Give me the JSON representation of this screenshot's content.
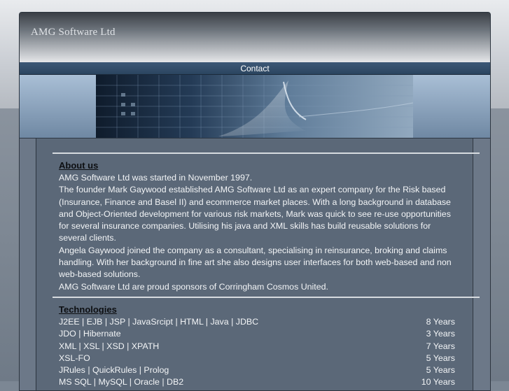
{
  "site": {
    "logo": "AMG Software Ltd"
  },
  "nav": {
    "items": [
      {
        "label": "Contact"
      }
    ]
  },
  "about": {
    "title": "About us",
    "paragraphs": [
      "AMG Software Ltd was started in November 1997.",
      "The founder Mark Gaywood established AMG Software Ltd as an expert company for the Risk based (Insurance, Finance and Basel II) and ecommerce market places. With a long background in database and Object-Oriented development for various risk markets, Mark was quick to see re-use opportunities for several insurance companies. Utilising his java and XML skills has build reusable solutions for several clients.",
      "Angela Gaywood joined the company as a consultant, specialising in reinsurance, broking and claims handling. With her background in fine art she also designs user interfaces for both web-based and non web-based solutions.",
      "AMG Software Ltd are proud sponsors of Corringham Cosmos United."
    ]
  },
  "technologies": {
    "title": "Technologies",
    "rows": [
      {
        "name": "J2EE | EJB | JSP | JavaSrcipt | HTML | Java | JDBC",
        "years": "8 Years"
      },
      {
        "name": "JDO | Hibernate",
        "years": "3 Years"
      },
      {
        "name": "XML | XSL | XSD | XPATH",
        "years": "7 Years"
      },
      {
        "name": "XSL-FO",
        "years": "5 Years"
      },
      {
        "name": "JRules | QuickRules | Prolog",
        "years": "5 Years"
      },
      {
        "name": "MS SQL | MySQL | Oracle | DB2",
        "years": "10 Years"
      }
    ]
  }
}
